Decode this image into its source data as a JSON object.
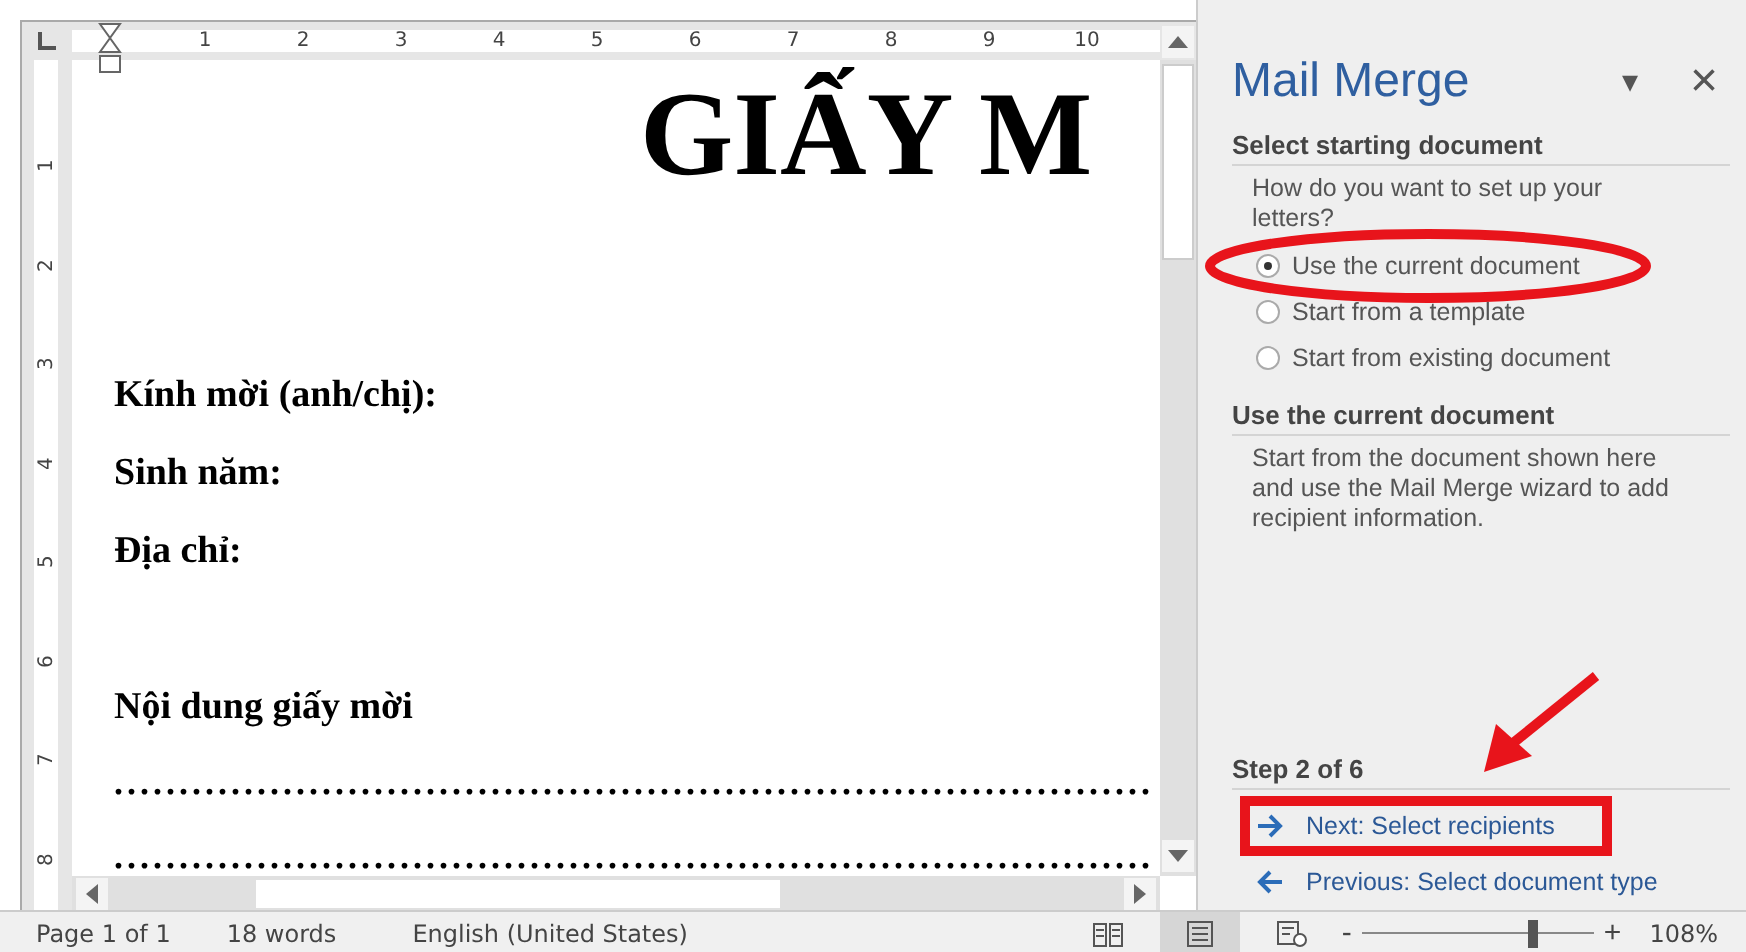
{
  "ruler": {
    "h_numbers": [
      "1",
      "2",
      "3",
      "4",
      "5",
      "6",
      "7",
      "8",
      "9",
      "10"
    ],
    "v_numbers": [
      "1",
      "2",
      "3",
      "4",
      "5",
      "6",
      "7",
      "8"
    ]
  },
  "document": {
    "title": "GIẤY M",
    "lines": [
      {
        "kind": "text",
        "text": "Kính mời (anh/chị):"
      },
      {
        "kind": "text",
        "text": "Sinh năm:"
      },
      {
        "kind": "text",
        "text": "Địa chỉ:"
      },
      {
        "kind": "gap"
      },
      {
        "kind": "text",
        "text": "Nội dung giấy mời"
      },
      {
        "kind": "dots",
        "text": "................................................................................"
      },
      {
        "kind": "dots",
        "text": "................................................................................"
      }
    ]
  },
  "pane": {
    "title": "Mail Merge",
    "menu_glyph": "▾",
    "close_glyph": "×",
    "section_1": {
      "heading": "Select starting document",
      "prompt": "How do you want to set up your letters?",
      "options": [
        {
          "label": "Use the current document",
          "selected": true
        },
        {
          "label": "Start from a template",
          "selected": false
        },
        {
          "label": "Start from existing document",
          "selected": false
        }
      ]
    },
    "section_2": {
      "heading": "Use the current document",
      "text": "Start from the document shown here and use the Mail Merge wizard to add recipient information."
    },
    "step": "Step 2 of 6",
    "links": [
      {
        "kind": "next",
        "label": "Next: Select recipients"
      },
      {
        "kind": "previous",
        "label": "Previous: Select document type"
      }
    ]
  },
  "annotations": [
    {
      "kind": "ellipse"
    },
    {
      "kind": "arrow"
    },
    {
      "kind": "rectangle"
    }
  ],
  "status_bar": {
    "page": "Page 1 of 1",
    "words": "18 words",
    "language": "English (United States)",
    "views": [
      {
        "kind": "read",
        "selected": false
      },
      {
        "kind": "print",
        "selected": true
      },
      {
        "kind": "web",
        "selected": false
      }
    ],
    "zoom": {
      "minus": "-",
      "plus": "+",
      "level": 0.73,
      "reading": "108%"
    }
  }
}
